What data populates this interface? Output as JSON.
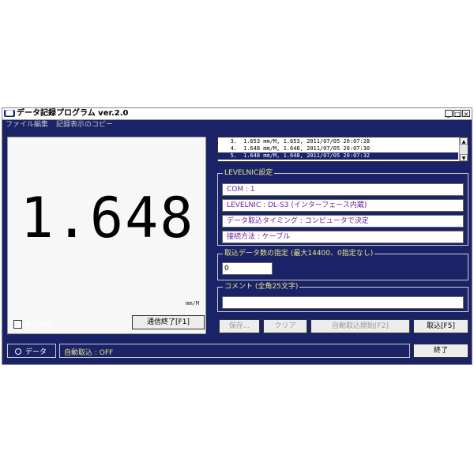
{
  "window": {
    "icon_text": "██",
    "title": "データ記録プログラム ver.2.0",
    "min_btn": "_",
    "max_btn": "□",
    "close_btn": "×"
  },
  "menu": [
    "ファイル",
    "編集",
    "記録表示のコピー"
  ],
  "display": {
    "value": "1.648",
    "unit": "mm/M",
    "show_only_label": "表示のみ",
    "stop_comm_button": "通信終了[F1]"
  },
  "log": [
    {
      "n": "3.",
      "text": "1.653 mm/M,   1.653, 2011/07/05 20:07:28",
      "selected": false
    },
    {
      "n": "4.",
      "text": "1.648 mm/M,   1.648, 2011/07/05 20:07:30",
      "selected": false
    },
    {
      "n": "5.",
      "text": "1.648 mm/M,   1.648, 2011/07/05 20:07:32",
      "selected": true
    }
  ],
  "levelnic": {
    "title": "LEVELNIC設定",
    "com": "COM : 1",
    "model": "LEVELNIC : DL-S3 (インターフェース内蔵)",
    "timing": "データ取込タイミング : コンピュータで決定",
    "connection": "接続方法 : ケーブル"
  },
  "count": {
    "title": "取込データ数の指定 (最大14400、0指定なし)",
    "value": "0"
  },
  "comment": {
    "title": "コメント (全角25文字)",
    "value": ""
  },
  "buttons": {
    "save": "保存...",
    "clear": "クリア",
    "auto_start": "自動取込開始[F2]",
    "capture": "取込[F5]",
    "exit": "終了"
  },
  "status": {
    "data_label": "データ",
    "auto_capture": "自動取込 : OFF"
  }
}
